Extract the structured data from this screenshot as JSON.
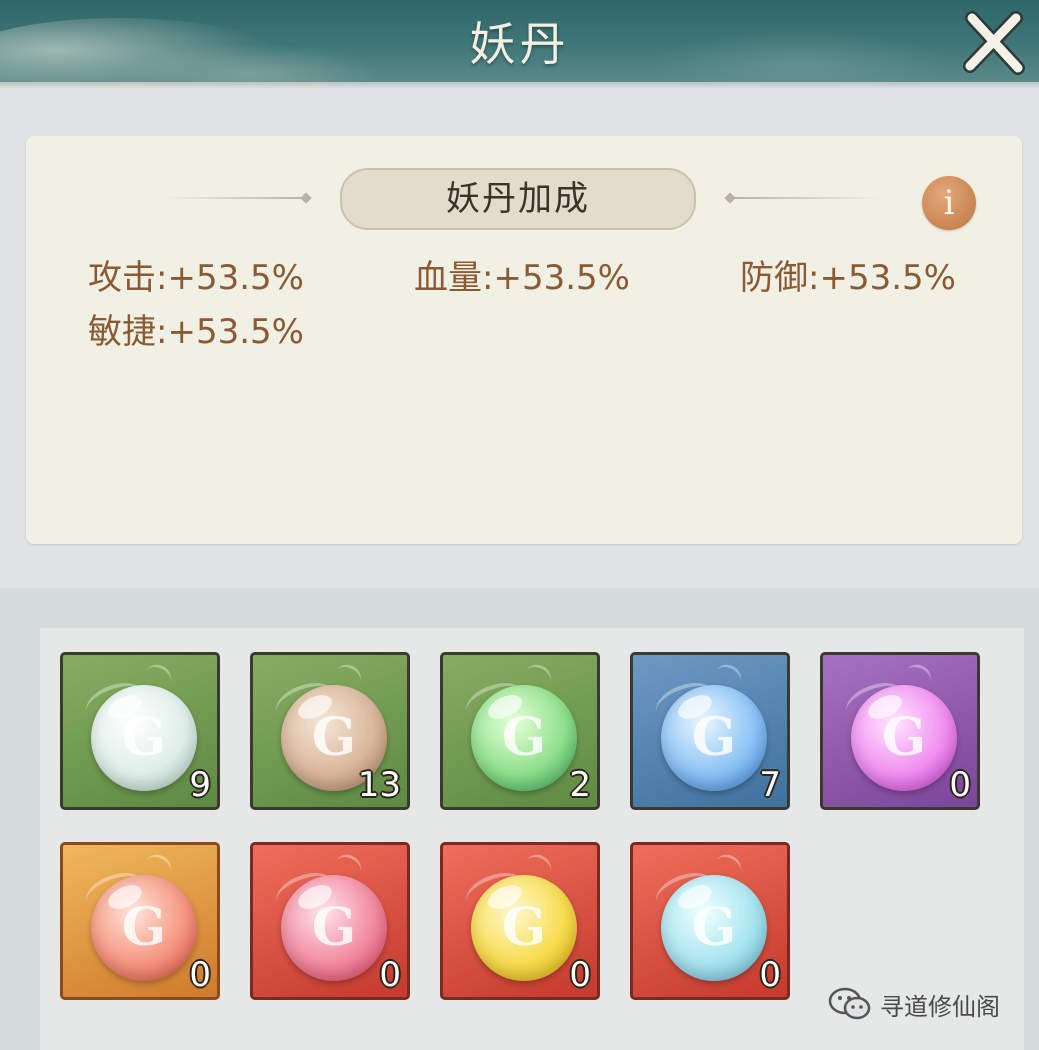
{
  "header": {
    "title": "妖丹"
  },
  "bonus": {
    "title": "妖丹加成",
    "info_label": "i",
    "stats": [
      {
        "label": "攻击:+53.5%"
      },
      {
        "label": "血量:+53.5%"
      },
      {
        "label": "防御:+53.5%"
      },
      {
        "label": "敏捷:+53.5%"
      }
    ]
  },
  "pills": [
    {
      "frame": "green",
      "orb": "white",
      "count": "9"
    },
    {
      "frame": "green",
      "orb": "tan",
      "count": "13"
    },
    {
      "frame": "green",
      "orb": "green",
      "count": "2"
    },
    {
      "frame": "blue",
      "orb": "blue",
      "count": "7"
    },
    {
      "frame": "purple",
      "orb": "purple",
      "count": "0"
    },
    {
      "frame": "orange",
      "orb": "salmon",
      "count": "0"
    },
    {
      "frame": "red",
      "orb": "pink",
      "count": "0"
    },
    {
      "frame": "red",
      "orb": "yellow",
      "count": "0"
    },
    {
      "frame": "red",
      "orb": "cyan",
      "count": "0"
    }
  ],
  "orb_colors": {
    "white": [
      "#ffffff",
      "#dfeee8",
      "#a9c7bd"
    ],
    "tan": [
      "#f5e6d6",
      "#d9b79b",
      "#a77e60"
    ],
    "green": [
      "#e6ffd9",
      "#8fe08c",
      "#2fa55a"
    ],
    "blue": [
      "#eaf6ff",
      "#8cc3f5",
      "#3b7fd6"
    ],
    "purple": [
      "#ffe6ff",
      "#f090ef",
      "#c03ad0"
    ],
    "salmon": [
      "#ffe5da",
      "#f59680",
      "#d64e3c"
    ],
    "pink": [
      "#ffe3ea",
      "#f28aa0",
      "#d83a5a"
    ],
    "yellow": [
      "#fff9d0",
      "#f7dc4e",
      "#d6a40e"
    ],
    "cyan": [
      "#f0ffff",
      "#a8e4ef",
      "#5fb0cf"
    ]
  },
  "watermark": {
    "text": "寻道修仙阁"
  }
}
